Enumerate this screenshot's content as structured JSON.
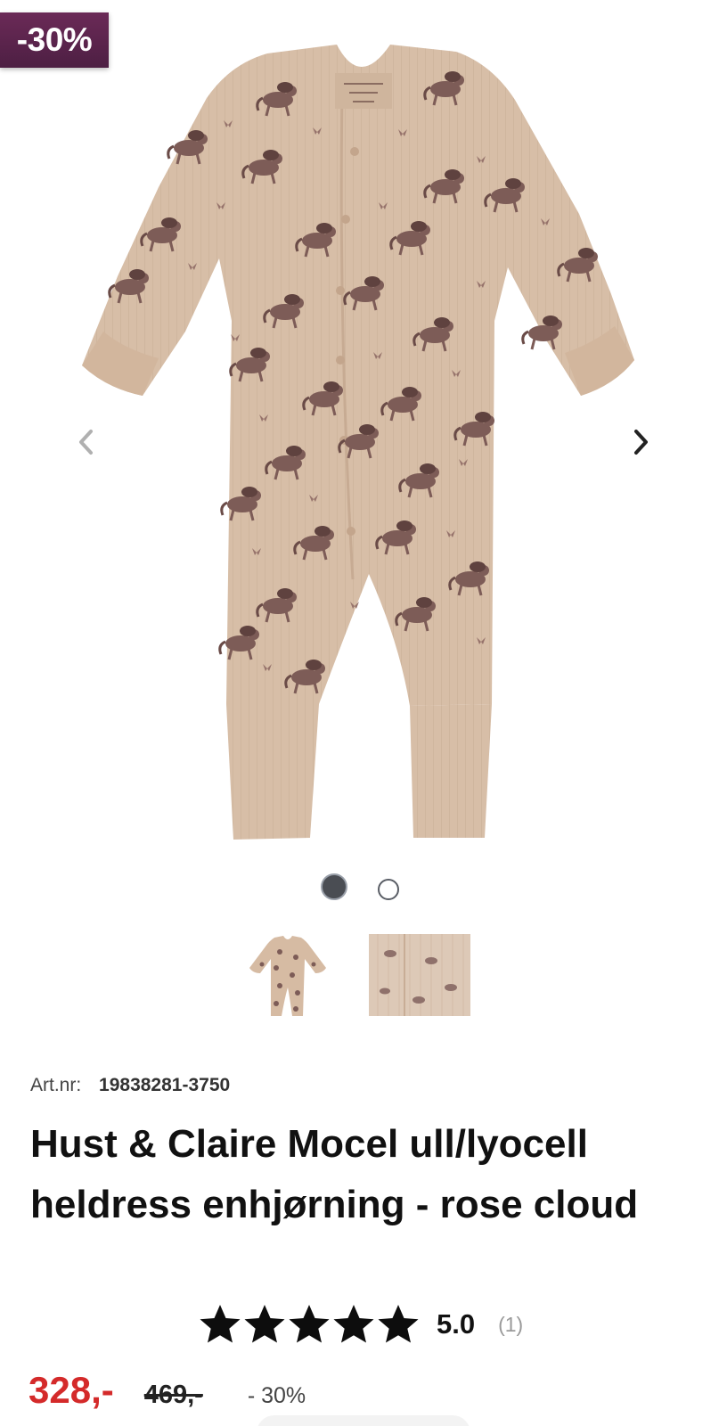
{
  "badge": {
    "discount": "-30%",
    "color": "#5b2450"
  },
  "gallery": {
    "prev_icon": "chevron-left-icon",
    "next_icon": "chevron-right-icon",
    "dot_count": 2,
    "active_index": 0,
    "thumbnails": [
      {
        "kind": "product-photo-full"
      },
      {
        "kind": "fabric-closeup"
      }
    ]
  },
  "product": {
    "artnr_label": "Art.nr:",
    "artnr_value": "19838281-3750",
    "title": "Hust & Claire Mocel ull/lyocell heldress enhjørning - rose cloud"
  },
  "rating": {
    "stars": 5,
    "star_icon": "star-icon",
    "value": "5.0",
    "count": "(1)"
  },
  "price": {
    "sale": "328,-",
    "original": "469,-",
    "discount": "- 30%",
    "sale_color": "#d42a2a"
  }
}
